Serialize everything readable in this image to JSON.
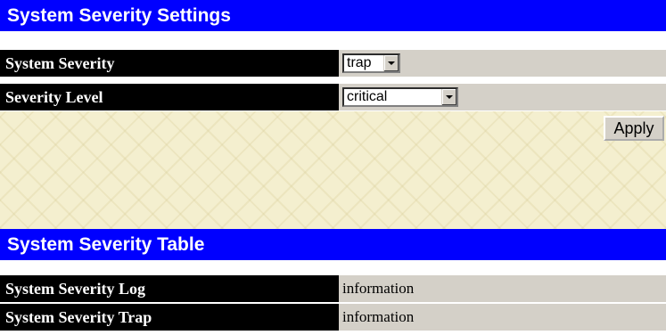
{
  "settings": {
    "title": "System Severity Settings",
    "system_severity": {
      "label": "System Severity",
      "selected": "trap"
    },
    "severity_level": {
      "label": "Severity Level",
      "selected": "critical"
    },
    "apply_label": "Apply"
  },
  "table": {
    "title": "System Severity Table",
    "rows": [
      {
        "label": "System Severity Log",
        "value": "information"
      },
      {
        "label": "System Severity Trap",
        "value": "information"
      }
    ]
  }
}
